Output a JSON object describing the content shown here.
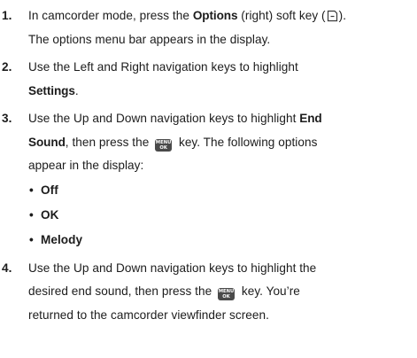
{
  "steps": [
    {
      "number": "1.",
      "line1_a": "In camcorder mode, press the ",
      "line1_bold": "Options",
      "line1_b": " (right) soft key (",
      "line1_c": ").",
      "icon": "right-softkey-icon",
      "line2": "The options menu bar appears in the display."
    },
    {
      "number": "2.",
      "line1": "Use the Left and Right navigation keys to highlight",
      "line2_bold": "Settings",
      "line2_end": "."
    },
    {
      "number": "3.",
      "line1_a": "Use the Up and Down navigation keys to highlight ",
      "line1_bold": "End",
      "line2_bold": "Sound",
      "line2_a": ", then press the ",
      "line2_b": " key. The following options",
      "line3": "appear in the display:",
      "options": [
        "Off",
        "OK",
        "Melody"
      ],
      "bullet": "•"
    },
    {
      "number": "4.",
      "line1": "Use the Up and Down navigation keys to highlight the",
      "line2_a": "desired end sound, then press the ",
      "line2_b": " key. You’re",
      "line3": "returned to the camcorder viewfinder screen."
    }
  ],
  "menu_key": {
    "top": "MENU",
    "bottom": "OK",
    "icon": "menu-ok-key-icon"
  }
}
